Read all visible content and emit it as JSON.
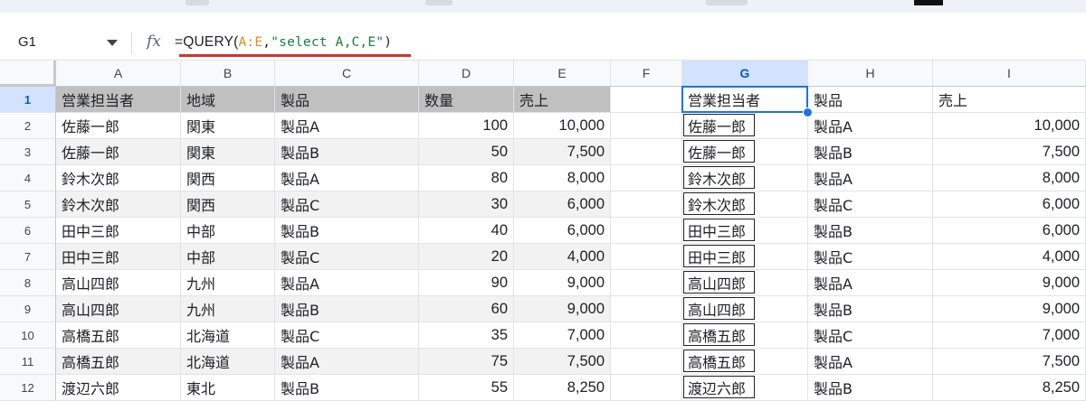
{
  "formula_bar": {
    "name_box": "G1",
    "fx": "fx",
    "formula_parts": [
      {
        "text": "=QUERY(",
        "color": "default",
        "mono": false
      },
      {
        "text": "A:E",
        "color": "orange",
        "mono": true
      },
      {
        "text": ",",
        "color": "default",
        "mono": true
      },
      {
        "text": "\"select A,C,E\"",
        "color": "green",
        "mono": true
      },
      {
        "text": ")",
        "color": "default",
        "mono": true
      }
    ]
  },
  "columns": [
    "A",
    "B",
    "C",
    "D",
    "E",
    "F",
    "G",
    "H",
    "I"
  ],
  "selected_column": "G",
  "selected_row": "1",
  "rows": [
    "1",
    "2",
    "3",
    "4",
    "5",
    "6",
    "7",
    "8",
    "9",
    "10",
    "11",
    "12"
  ],
  "source_header": [
    "営業担当者",
    "地域",
    "製品",
    "数量",
    "売上"
  ],
  "source_rows": [
    [
      "佐藤一郎",
      "関東",
      "製品A",
      "100",
      "10,000"
    ],
    [
      "佐藤一郎",
      "関東",
      "製品B",
      "50",
      "7,500"
    ],
    [
      "鈴木次郎",
      "関西",
      "製品A",
      "80",
      "8,000"
    ],
    [
      "鈴木次郎",
      "関西",
      "製品C",
      "30",
      "6,000"
    ],
    [
      "田中三郎",
      "中部",
      "製品B",
      "40",
      "6,000"
    ],
    [
      "田中三郎",
      "中部",
      "製品C",
      "20",
      "4,000"
    ],
    [
      "高山四郎",
      "九州",
      "製品A",
      "90",
      "9,000"
    ],
    [
      "高山四郎",
      "九州",
      "製品B",
      "60",
      "9,000"
    ],
    [
      "高橋五郎",
      "北海道",
      "製品C",
      "35",
      "7,000"
    ],
    [
      "高橋五郎",
      "北海道",
      "製品A",
      "75",
      "7,500"
    ],
    [
      "渡辺六郎",
      "東北",
      "製品B",
      "55",
      "8,250"
    ]
  ],
  "result_header": [
    "営業担当者",
    "製品",
    "売上"
  ],
  "result_rows": [
    [
      "佐藤一郎",
      "製品A",
      "10,000"
    ],
    [
      "佐藤一郎",
      "製品B",
      "7,500"
    ],
    [
      "鈴木次郎",
      "製品A",
      "8,000"
    ],
    [
      "鈴木次郎",
      "製品C",
      "6,000"
    ],
    [
      "田中三郎",
      "製品B",
      "6,000"
    ],
    [
      "田中三郎",
      "製品C",
      "4,000"
    ],
    [
      "高山四郎",
      "製品A",
      "9,000"
    ],
    [
      "高山四郎",
      "製品B",
      "9,000"
    ],
    [
      "高橋五郎",
      "製品C",
      "7,000"
    ],
    [
      "高橋五郎",
      "製品A",
      "7,500"
    ],
    [
      "渡辺六郎",
      "製品B",
      "8,250"
    ]
  ],
  "colors": {
    "accent": "#1a73e8",
    "header_fill": "#c0c0c0",
    "band_fill": "#f2f2f2",
    "formula_range": "#d98d1e",
    "formula_string": "#188038",
    "underline": "#d93025"
  }
}
